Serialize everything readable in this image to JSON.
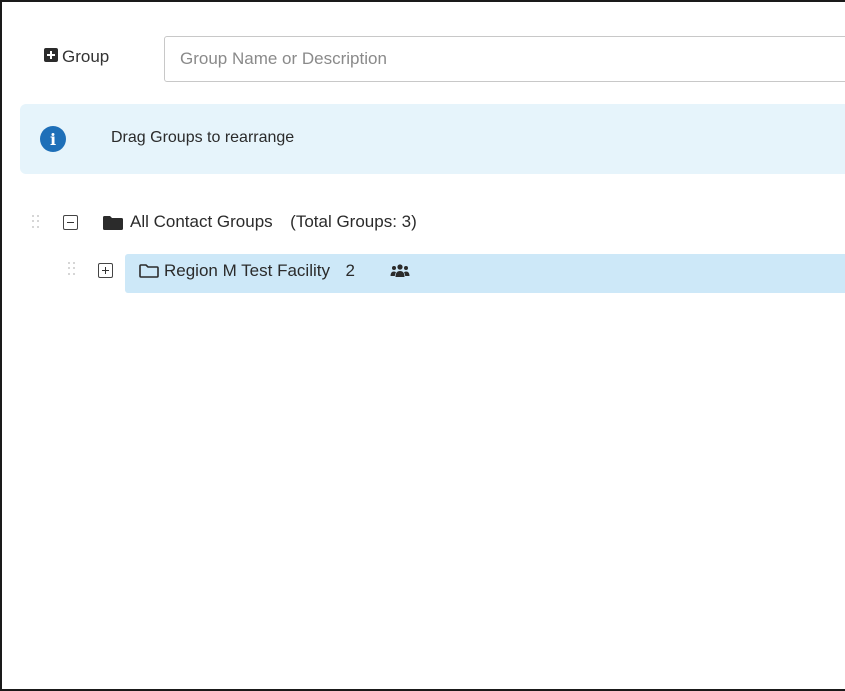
{
  "toolbar": {
    "add_group_label": "Group",
    "search_placeholder": "Group Name or Description",
    "search_value": ""
  },
  "info_banner": {
    "icon": "info-icon",
    "text": "Drag Groups to rearrange"
  },
  "tree": {
    "root": {
      "label": "All Contact Groups",
      "summary": "(Total Groups: 3)",
      "expanded": true,
      "icon": "folder-filled-icon"
    },
    "children": [
      {
        "label": "Region M Test Facility",
        "count": "2",
        "expanded": false,
        "selected": true,
        "icon": "folder-outline-icon",
        "count_icon": "people-icon"
      }
    ]
  },
  "colors": {
    "banner_bg": "#e6f4fb",
    "info_icon": "#1e6fb8",
    "selected_row": "#cde8f8"
  }
}
